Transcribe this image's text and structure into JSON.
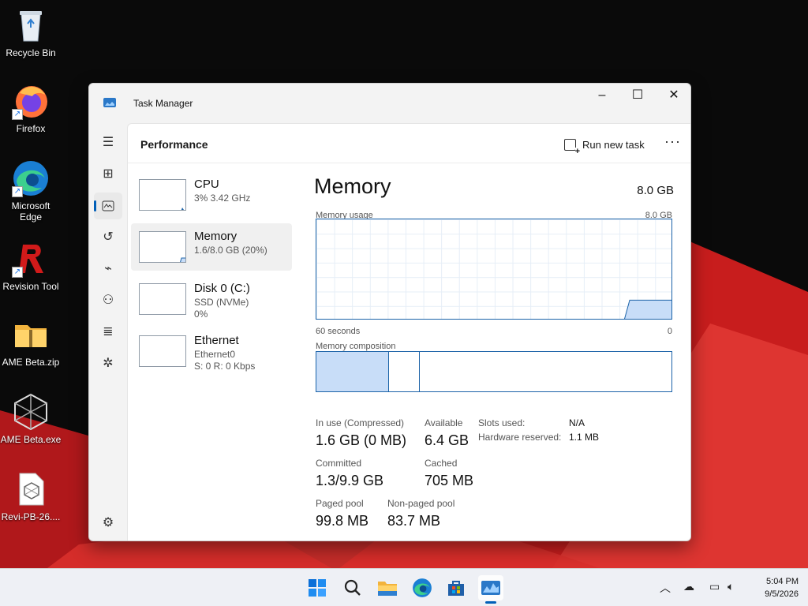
{
  "desktop": {
    "icons": [
      {
        "label": "Recycle Bin"
      },
      {
        "label": "Firefox"
      },
      {
        "label": "Microsoft Edge"
      },
      {
        "label": "Revision Tool"
      },
      {
        "label": "AME Beta.zip"
      },
      {
        "label": "AME Beta.exe"
      },
      {
        "label": "Revi-PB-26...."
      }
    ]
  },
  "window": {
    "title": "Task Manager",
    "page_title": "Performance",
    "run_new_task": "Run new task",
    "more": "···"
  },
  "devices": [
    {
      "name": "CPU",
      "line1": "3% 3.42 GHz",
      "line2": "",
      "line3": ""
    },
    {
      "name": "Memory",
      "line1": "1.6/8.0 GB (20%)",
      "line2": "",
      "line3": ""
    },
    {
      "name": "Disk 0 (C:)",
      "line1": "SSD (NVMe)",
      "line2": "0%",
      "line3": ""
    },
    {
      "name": "Ethernet",
      "line1": "Ethernet0",
      "line2": "S: 0 R: 0 Kbps",
      "line3": ""
    }
  ],
  "memory": {
    "title": "Memory",
    "total": "8.0 GB",
    "usage_label": "Memory usage",
    "usage_max": "8.0 GB",
    "axis_left": "60 seconds",
    "axis_right": "0",
    "composition_label": "Memory composition",
    "usage_fraction": 0.2,
    "stats": {
      "in_use_label": "In use (Compressed)",
      "in_use_value": "1.6 GB (0 MB)",
      "available_label": "Available",
      "available_value": "6.4 GB",
      "committed_label": "Committed",
      "committed_value": "1.3/9.9 GB",
      "cached_label": "Cached",
      "cached_value": "705 MB",
      "paged_label": "Paged pool",
      "paged_value": "99.8 MB",
      "nonpaged_label": "Non-paged pool",
      "nonpaged_value": "83.7 MB",
      "slots_label": "Slots used:",
      "slots_value": "N/A",
      "hw_label": "Hardware reserved:",
      "hw_value": "1.1 MB"
    }
  },
  "clock": {
    "time": "5:04 PM",
    "date": "9/5/2026"
  },
  "colors": {
    "accent": "#005fb8",
    "graph_line": "#1c63a8",
    "graph_fill": "#c8ddf8"
  }
}
